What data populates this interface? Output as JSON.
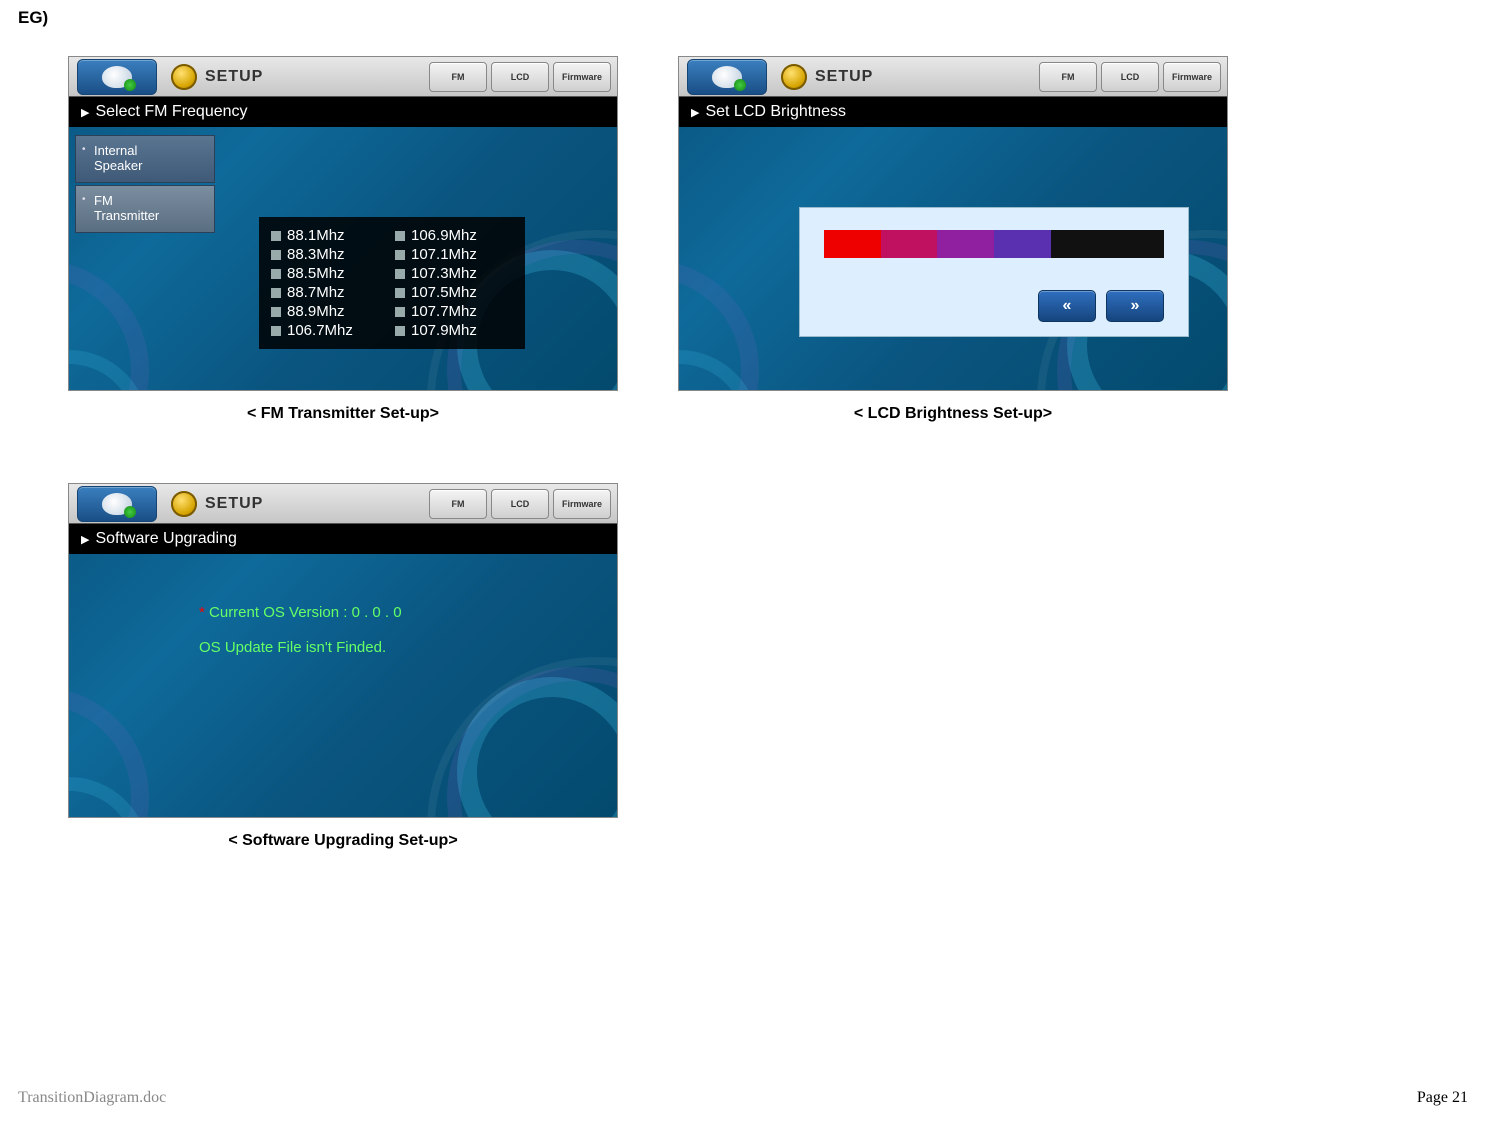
{
  "header": "EG)",
  "common": {
    "setup_label": "SETUP",
    "tabs": {
      "fm": "FM",
      "lcd": "LCD",
      "firmware": "Firmware"
    }
  },
  "panel_fm": {
    "title": "Select FM Frequency",
    "side": {
      "internal": "Internal\nSpeaker",
      "fm": "FM\nTransmitter"
    },
    "freqs_col1": [
      "88.1Mhz",
      "88.3Mhz",
      "88.5Mhz",
      "88.7Mhz",
      "88.9Mhz",
      "106.7Mhz"
    ],
    "freqs_col2": [
      "106.9Mhz",
      "107.1Mhz",
      "107.3Mhz",
      "107.5Mhz",
      "107.7Mhz",
      "107.9Mhz"
    ],
    "caption": "< FM Transmitter Set-up>"
  },
  "panel_lcd": {
    "title": "Set LCD Brightness",
    "prev": "«",
    "next": "»",
    "caption": "< LCD Brightness Set-up>"
  },
  "panel_sw": {
    "title": "Software Upgrading",
    "line1": "Current OS Version  : 0 . 0 . 0",
    "line2": "OS Update File isn't Finded.",
    "caption": "< Software Upgrading Set-up>"
  },
  "footer": {
    "file": "TransitionDiagram.doc",
    "page": "Page 21"
  }
}
